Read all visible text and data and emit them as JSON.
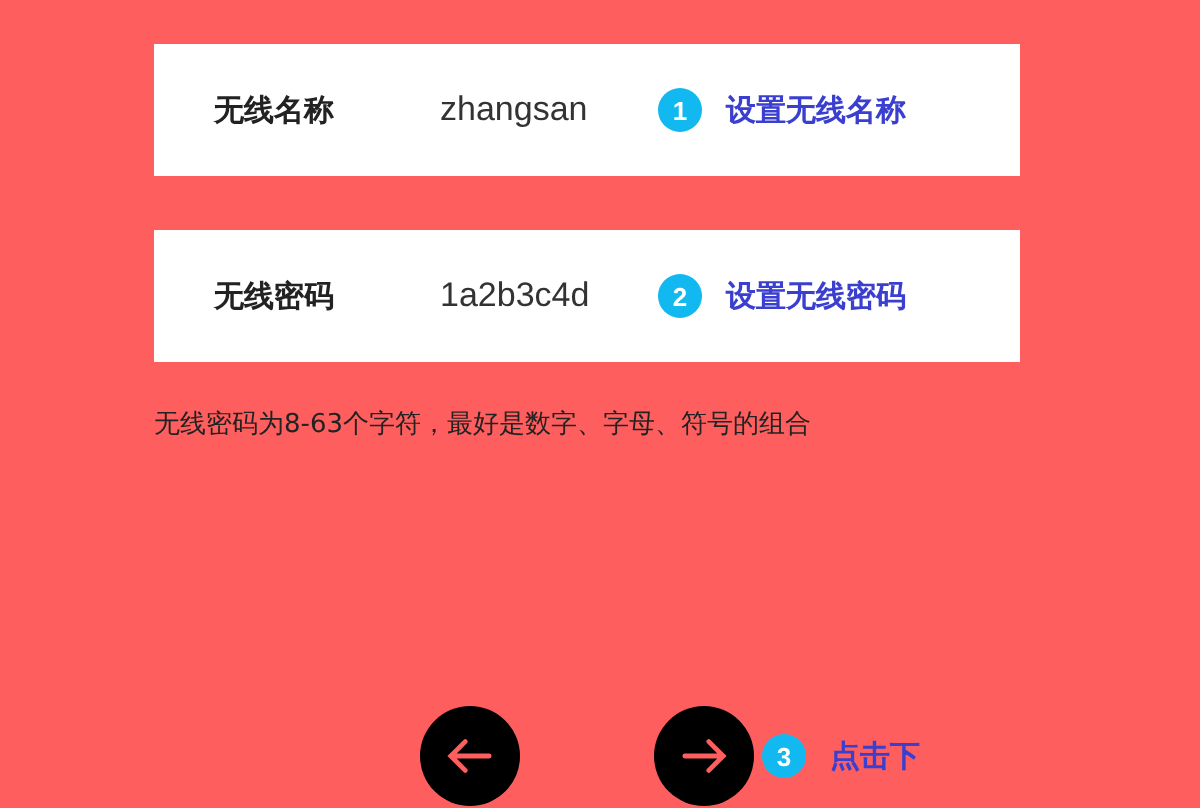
{
  "fields": [
    {
      "label": "无线名称",
      "value": "zhangsan",
      "step": "1",
      "link": "设置无线名称"
    },
    {
      "label": "无线密码",
      "value": "1a2b3c4d",
      "step": "2",
      "link": "设置无线密码"
    }
  ],
  "hint": "无线密码为8-63个字符，最好是数字、字母、符号的组合",
  "next_step": {
    "step": "3",
    "text": "点击下"
  }
}
